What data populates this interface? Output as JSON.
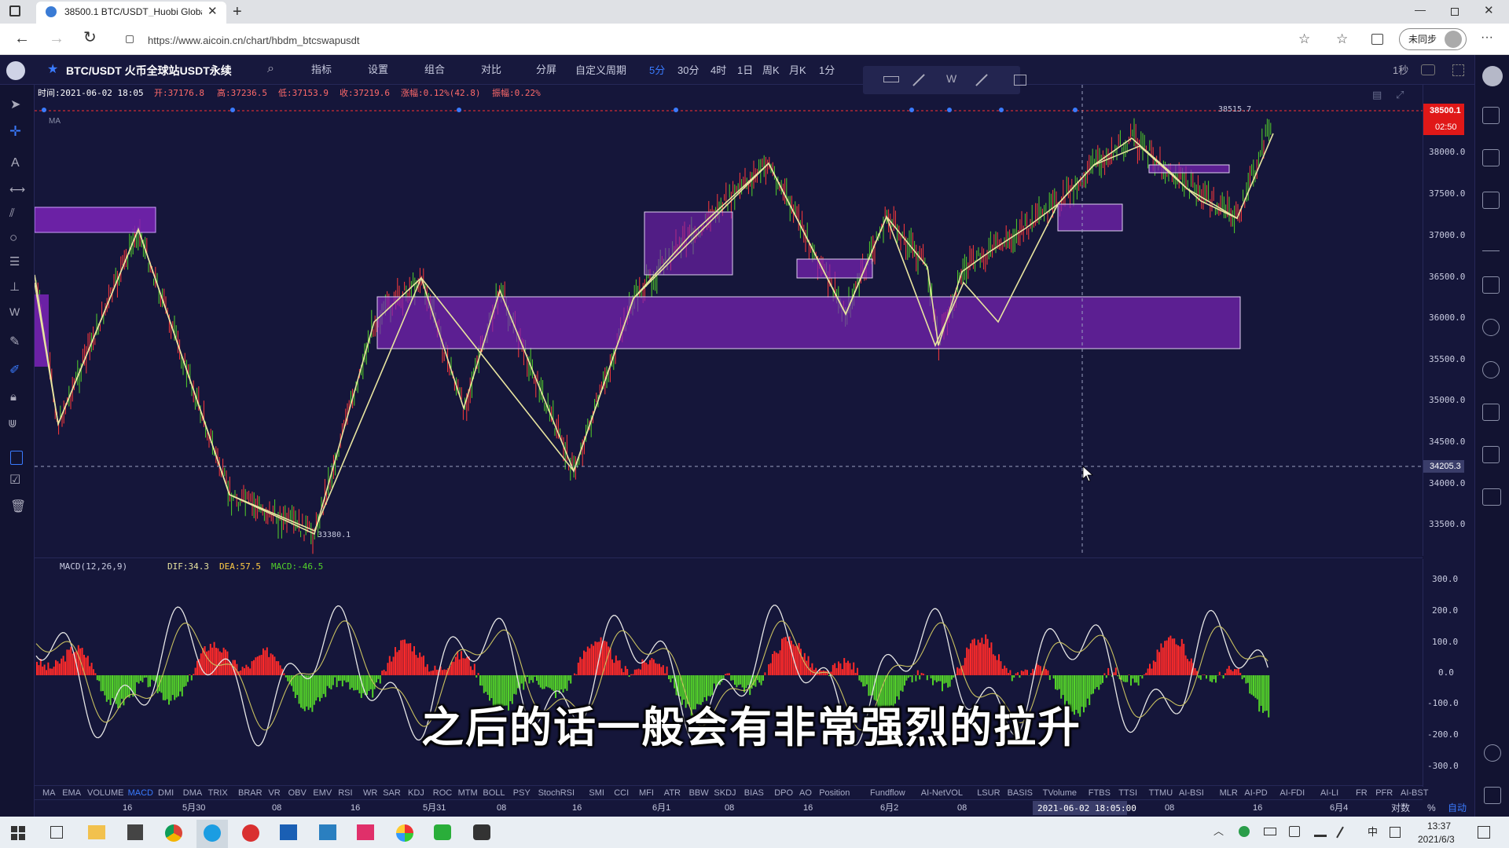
{
  "browser": {
    "tab_title": "38500.1 BTC/USDT_Huobi Globa",
    "url": "https://www.aicoin.cn/chart/hbdm_btcswapusdt",
    "sync_label": "未同步"
  },
  "toolbar": {
    "symbol": "BTC/USDT 火币全球站USDT永续",
    "items": [
      "指标",
      "设置",
      "组合",
      "对比",
      "分屏"
    ],
    "period_menu": "自定义周期",
    "periods": [
      "5分",
      "30分",
      "4时",
      "1日",
      "周K",
      "月K",
      "1分"
    ],
    "active_period": "5分",
    "refresh": "1秒"
  },
  "info": {
    "time": "时间:2021-06-02 18:05",
    "open": "开:37176.8",
    "high": "高:37236.5",
    "low": "低:37153.9",
    "close": "收:37219.6",
    "change": "涨幅:0.12%(42.8)",
    "amp": "振幅:0.22%"
  },
  "ma_label": "MA",
  "price_axis": {
    "ticks": [
      "38000.0",
      "37500.0",
      "37000.0",
      "36500.0",
      "36000.0",
      "35500.0",
      "35000.0",
      "34500.0",
      "34000.0",
      "33500.0"
    ],
    "current": "38500.1",
    "countdown": "02:50",
    "cursor": "34205.3"
  },
  "annotations": {
    "high": "38515.7",
    "low": "33380.1"
  },
  "macd": {
    "label": "MACD(12,26,9)",
    "dif": "DIF:34.3",
    "dea": "DEA:57.5",
    "macd": "MACD:-46.5",
    "ticks": [
      "300.0",
      "200.0",
      "100.0",
      "0.0",
      "-100.0",
      "-200.0",
      "-300.0"
    ]
  },
  "indicators": [
    "MA",
    "EMA",
    "VOLUME",
    "MACD",
    "DMI",
    "DMA",
    "TRIX",
    "BRAR",
    "VR",
    "OBV",
    "EMV",
    "RSI",
    "WR",
    "SAR",
    "KDJ",
    "ROC",
    "MTM",
    "BOLL",
    "PSY",
    "StochRSI",
    "SMI",
    "CCI",
    "MFI",
    "ATR",
    "BBW",
    "SKDJ",
    "BIAS",
    "DPO",
    "AO",
    "Position",
    "Fundflow",
    "AI-NetVOL",
    "LSUR",
    "BASIS",
    "TVolume",
    "FTBS",
    "TTSI",
    "TTMU",
    "AI-BSI",
    "MLR",
    "AI-PD",
    "AI-FDI",
    "AI-LI",
    "FR",
    "PFR",
    "AI-BST"
  ],
  "active_indicator": "MACD",
  "time_axis": [
    "16",
    "5月30",
    "08",
    "16",
    "5月31",
    "08",
    "16",
    "6月1",
    "08",
    "16",
    "6月2",
    "08",
    "6月3",
    "08",
    "16",
    "6月4"
  ],
  "cursor_time": "2021-06-02 18:05:00",
  "axis_modes": [
    "对数",
    "%",
    "自动"
  ],
  "subtitle": "之后的话一般会有非常强烈的拉升",
  "clock": {
    "time": "13:37",
    "date": "2021/6/3"
  },
  "tray": {
    "ime": "中"
  },
  "colors": {
    "up": "#ff2a2a",
    "down": "#53d22a",
    "zone": "#7a23b8",
    "line": "#e8e4a0",
    "accent": "#3a7bff"
  }
}
